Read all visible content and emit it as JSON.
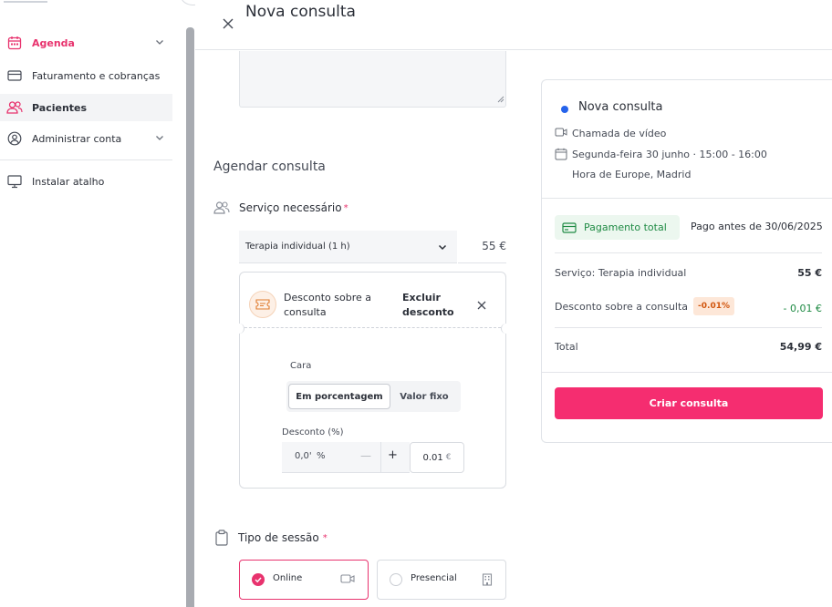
{
  "sidebar": {
    "items": [
      {
        "label": "Agenda",
        "icon": "calendar-icon"
      },
      {
        "label": "Faturamento e cobranças",
        "icon": "credit-card-icon"
      },
      {
        "label": "Pacientes",
        "icon": "users-icon"
      },
      {
        "label": "Administrar conta",
        "icon": "user-circle-icon"
      },
      {
        "label": "Instalar atalho",
        "icon": "monitor-icon"
      }
    ]
  },
  "header": {
    "title": "Nova consulta"
  },
  "form": {
    "section_title": "Agendar consulta",
    "service": {
      "label": "Serviço necessário",
      "required_mark": "*",
      "selected": "Terapia individual (1 h)",
      "price": "55 €"
    },
    "discount": {
      "title": "Desconto sobre a consulta",
      "remove_label": "Excluir desconto",
      "type_label": "Cara",
      "options": [
        "Em porcentagem",
        "Valor fixo"
      ],
      "selected_option": "Em porcentagem",
      "percent_label": "Desconto (%)",
      "percent_value": "0,0'",
      "percent_unit": "%",
      "minus": "—",
      "plus": "+",
      "amount_value": "0.01",
      "amount_currency": "€"
    },
    "session": {
      "label": "Tipo de sessão",
      "required_mark": "*",
      "options": [
        {
          "label": "Online",
          "selected": true,
          "icon": "video-icon"
        },
        {
          "label": "Presencial",
          "selected": false,
          "icon": "building-icon"
        }
      ]
    }
  },
  "summary": {
    "title": "Nova consulta",
    "call_type": "Chamada de vídeo",
    "datetime": "Segunda-feira 30 junho · 15:00 - 16:00",
    "timezone": "Hora de Europe, Madrid",
    "payment_badge": "Pagamento total",
    "pay_until": "Pago antes de 30/06/2025",
    "lines": [
      {
        "label": "Serviço: Terapia individual",
        "value": "55 €"
      },
      {
        "label": "Desconto sobre a consulta",
        "badge": "-0.01%",
        "value": "- 0,01 €"
      },
      {
        "label": "Total",
        "value": "54,99 €"
      }
    ],
    "cta": "Criar consulta"
  },
  "colors": {
    "accent": "#e8336e",
    "cta": "#f52d70",
    "success": "#1e8a43",
    "warning": "#d1560e",
    "dot": "#2563eb"
  }
}
